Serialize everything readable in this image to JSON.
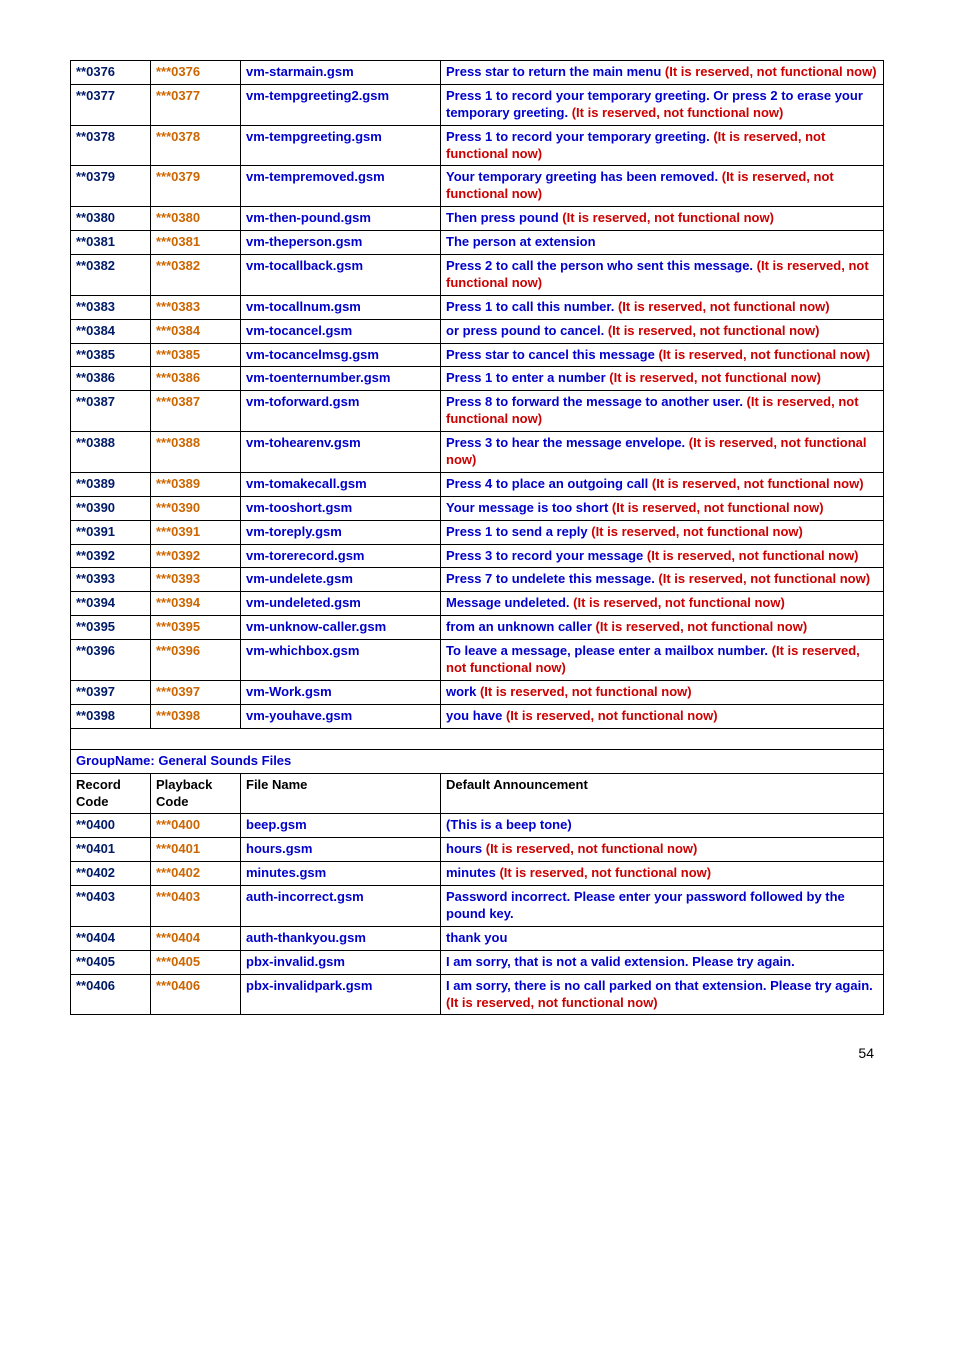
{
  "rows1": [
    {
      "rc": "**0376",
      "pc": "***0376",
      "fn": "vm-starmain.gsm",
      "parts": [
        {
          "t": "Press star to return the main menu ",
          "c": "blue"
        },
        {
          "t": "(It is reserved, not functional now)",
          "c": "red"
        }
      ]
    },
    {
      "rc": "**0377",
      "pc": "***0377",
      "fn": "vm-tempgreeting2.gsm",
      "parts": [
        {
          "t": "Press 1 to record your temporary greeting. Or press 2 to erase your temporary greeting. ",
          "c": "blue"
        },
        {
          "t": "(It is reserved, not functional now)",
          "c": "red"
        }
      ]
    },
    {
      "rc": "**0378",
      "pc": "***0378",
      "fn": "vm-tempgreeting.gsm",
      "parts": [
        {
          "t": "Press 1 to record your temporary greeting. ",
          "c": "blue"
        },
        {
          "t": "(It is reserved, not functional now)",
          "c": "red"
        }
      ]
    },
    {
      "rc": "**0379",
      "pc": "***0379",
      "fn": "vm-tempremoved.gsm",
      "parts": [
        {
          "t": "Your temporary greeting has been removed. ",
          "c": "blue"
        },
        {
          "t": "(It is reserved, not functional now)",
          "c": "red"
        }
      ]
    },
    {
      "rc": "**0380",
      "pc": "***0380",
      "fn": "vm-then-pound.gsm",
      "parts": [
        {
          "t": "Then press pound ",
          "c": "blue"
        },
        {
          "t": "(It is reserved, not functional now)",
          "c": "red"
        }
      ]
    },
    {
      "rc": "**0381",
      "pc": "***0381",
      "fn": "vm-theperson.gsm",
      "parts": [
        {
          "t": "The person at extension",
          "c": "blue"
        }
      ]
    },
    {
      "rc": "**0382",
      "pc": "***0382",
      "fn": "vm-tocallback.gsm",
      "parts": [
        {
          "t": "Press 2 to call the person who sent this message. ",
          "c": "blue"
        },
        {
          "t": "(It is reserved, not functional now)",
          "c": "red"
        }
      ]
    },
    {
      "rc": "**0383",
      "pc": "***0383",
      "fn": "vm-tocallnum.gsm",
      "parts": [
        {
          "t": "Press 1 to call this number. ",
          "c": "blue"
        },
        {
          "t": "(It is reserved, not functional now)",
          "c": "red"
        }
      ]
    },
    {
      "rc": "**0384",
      "pc": "***0384",
      "fn": "vm-tocancel.gsm",
      "parts": [
        {
          "t": "or press pound to cancel. ",
          "c": "blue"
        },
        {
          "t": "(It is reserved, not functional now)",
          "c": "red"
        }
      ]
    },
    {
      "rc": "**0385",
      "pc": "***0385",
      "fn": "vm-tocancelmsg.gsm",
      "parts": [
        {
          "t": "Press star to cancel this message ",
          "c": "blue"
        },
        {
          "t": "(It is reserved, not functional now)",
          "c": "red"
        }
      ]
    },
    {
      "rc": "**0386",
      "pc": "***0386",
      "fn": "vm-toenternumber.gsm",
      "parts": [
        {
          "t": "Press 1 to enter a number ",
          "c": "blue"
        },
        {
          "t": "(It is reserved, not functional now)",
          "c": "red"
        }
      ]
    },
    {
      "rc": "**0387",
      "pc": "***0387",
      "fn": "vm-toforward.gsm",
      "parts": [
        {
          "t": "Press 8 to forward the message to another user. ",
          "c": "blue"
        },
        {
          "t": "(It is reserved, not functional now)",
          "c": "red"
        }
      ]
    },
    {
      "rc": "**0388",
      "pc": "***0388",
      "fn": "vm-tohearenv.gsm",
      "parts": [
        {
          "t": "Press 3 to hear the message envelope. ",
          "c": "blue"
        },
        {
          "t": "(It is reserved, not functional now)",
          "c": "red"
        }
      ]
    },
    {
      "rc": "**0389",
      "pc": "***0389",
      "fn": "vm-tomakecall.gsm",
      "parts": [
        {
          "t": "Press 4 to place an outgoing call ",
          "c": "blue"
        },
        {
          "t": "(It is reserved, not functional now)",
          "c": "red"
        }
      ]
    },
    {
      "rc": "**0390",
      "pc": "***0390",
      "fn": "vm-tooshort.gsm",
      "parts": [
        {
          "t": "Your message is too short ",
          "c": "blue"
        },
        {
          "t": "(It is reserved, not functional now)",
          "c": "red"
        }
      ]
    },
    {
      "rc": "**0391",
      "pc": "***0391",
      "fn": "vm-toreply.gsm",
      "parts": [
        {
          "t": "Press 1 to send a reply ",
          "c": "blue"
        },
        {
          "t": "(It is reserved, not functional now)",
          "c": "red"
        }
      ]
    },
    {
      "rc": "**0392",
      "pc": "***0392",
      "fn": "vm-torerecord.gsm",
      "parts": [
        {
          "t": "Press 3 to record your message ",
          "c": "blue"
        },
        {
          "t": "(It is reserved, not functional now)",
          "c": "red"
        }
      ]
    },
    {
      "rc": "**0393",
      "pc": "***0393",
      "fn": "vm-undelete.gsm",
      "parts": [
        {
          "t": "Press 7 to undelete this message. ",
          "c": "blue"
        },
        {
          "t": "(It is reserved, not functional now)",
          "c": "red"
        }
      ]
    },
    {
      "rc": "**0394",
      "pc": "***0394",
      "fn": "vm-undeleted.gsm",
      "parts": [
        {
          "t": "Message undeleted. ",
          "c": "blue"
        },
        {
          "t": "(It is reserved, not functional now)",
          "c": "red"
        }
      ]
    },
    {
      "rc": "**0395",
      "pc": "***0395",
      "fn": "vm-unknow-caller.gsm",
      "parts": [
        {
          "t": "from an unknown caller ",
          "c": "blue"
        },
        {
          "t": "(It is reserved, not functional now)",
          "c": "red"
        }
      ]
    },
    {
      "rc": "**0396",
      "pc": "***0396",
      "fn": "vm-whichbox.gsm",
      "parts": [
        {
          "t": "To leave a message, please enter a mailbox number. ",
          "c": "blue"
        },
        {
          "t": "(It is reserved, not functional now)",
          "c": "red"
        }
      ]
    },
    {
      "rc": "**0397",
      "pc": "***0397",
      "fn": "vm-Work.gsm",
      "parts": [
        {
          "t": "work ",
          "c": "blue"
        },
        {
          "t": "(It is reserved, not functional now)",
          "c": "red"
        }
      ]
    },
    {
      "rc": "**0398",
      "pc": "***0398",
      "fn": "vm-youhave.gsm",
      "parts": [
        {
          "t": "you have ",
          "c": "blue"
        },
        {
          "t": "(It is reserved, not functional now)",
          "c": "red"
        }
      ]
    }
  ],
  "group2": {
    "title": "GroupName: General Sounds Files",
    "headers": {
      "rc": "Record Code",
      "pc": "Playback Code",
      "fn": "File Name",
      "da": "Default Announcement"
    }
  },
  "rows2": [
    {
      "rc": "**0400",
      "pc": "***0400",
      "fn": "beep.gsm",
      "parts": [
        {
          "t": "(This is a beep tone)",
          "c": "blue"
        }
      ]
    },
    {
      "rc": "**0401",
      "pc": "***0401",
      "fn": "hours.gsm",
      "parts": [
        {
          "t": "hours ",
          "c": "blue"
        },
        {
          "t": "(It is reserved, not functional now)",
          "c": "red"
        }
      ]
    },
    {
      "rc": "**0402",
      "pc": "***0402",
      "fn": "minutes.gsm",
      "parts": [
        {
          "t": "minutes ",
          "c": "blue"
        },
        {
          "t": "(It is reserved, not functional now)",
          "c": "red"
        }
      ]
    },
    {
      "rc": "**0403",
      "pc": "***0403",
      "fn": "auth-incorrect.gsm",
      "parts": [
        {
          "t": "Password incorrect. Please enter your password followed by the pound key.",
          "c": "blue"
        }
      ]
    },
    {
      "rc": "**0404",
      "pc": "***0404",
      "fn": "auth-thankyou.gsm",
      "parts": [
        {
          "t": "thank you",
          "c": "blue"
        }
      ]
    },
    {
      "rc": "**0405",
      "pc": "***0405",
      "fn": "pbx-invalid.gsm",
      "parts": [
        {
          "t": "I am sorry, that is not a valid extension. Please try again.",
          "c": "blue"
        }
      ]
    },
    {
      "rc": "**0406",
      "pc": "***0406",
      "fn": "pbx-invalidpark.gsm",
      "parts": [
        {
          "t": "I am sorry, there is no call parked on that extension. Please try again. ",
          "c": "blue"
        },
        {
          "t": "(It is reserved, not functional now)",
          "c": "red"
        }
      ]
    }
  ],
  "page_number": "54"
}
